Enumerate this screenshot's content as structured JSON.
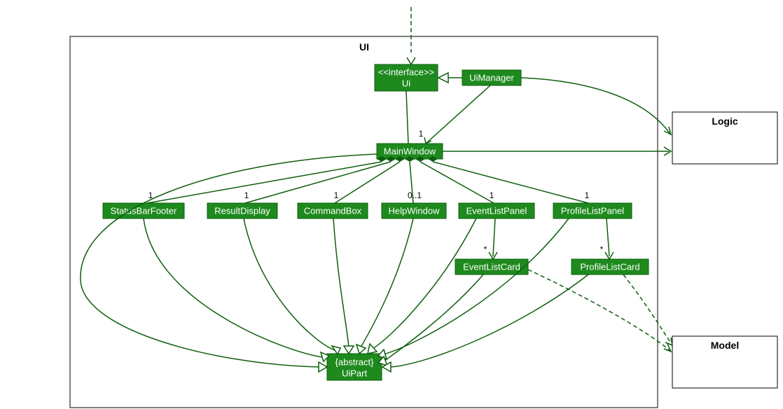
{
  "package": {
    "label": "UI"
  },
  "external": {
    "logic": "Logic",
    "model": "Model"
  },
  "classes": {
    "ui_stereo": "<<interface>>",
    "ui": "Ui",
    "uimanager": "UiManager",
    "mainwindow": "MainWindow",
    "statusbarfooter": "StatusBarFooter",
    "resultdisplay": "ResultDisplay",
    "commandbox": "CommandBox",
    "helpwindow": "HelpWindow",
    "eventlistpanel": "EventListPanel",
    "profilelistpanel": "ProfileListPanel",
    "eventlistcard": "EventListCard",
    "profilelistcard": "ProfileListCard",
    "uipart_stereo": "{abstract}",
    "uipart": "UiPart"
  },
  "mult": {
    "mw": "1",
    "sbf": "1",
    "rd": "1",
    "cb": "1",
    "hw": "0..1",
    "elp": "1",
    "plp": "1",
    "elc": "*",
    "plc": "*"
  },
  "diagram_data": {
    "type": "uml_class_diagram",
    "package": "UI",
    "classes": [
      {
        "name": "Ui",
        "stereotype": "interface"
      },
      {
        "name": "UiManager"
      },
      {
        "name": "MainWindow"
      },
      {
        "name": "StatusBarFooter"
      },
      {
        "name": "ResultDisplay"
      },
      {
        "name": "CommandBox"
      },
      {
        "name": "HelpWindow"
      },
      {
        "name": "EventListPanel"
      },
      {
        "name": "ProfileListPanel"
      },
      {
        "name": "EventListCard"
      },
      {
        "name": "ProfileListCard"
      },
      {
        "name": "UiPart",
        "stereotype": "abstract"
      }
    ],
    "external_classes": [
      "Logic",
      "Model"
    ],
    "relationships": [
      {
        "from": "UiManager",
        "to": "Ui",
        "type": "realization"
      },
      {
        "from": "UiManager",
        "to": "MainWindow",
        "type": "association",
        "mult_to": "1"
      },
      {
        "from": "UiManager",
        "to": "Logic",
        "type": "association"
      },
      {
        "from": "MainWindow",
        "to": "Logic",
        "type": "association"
      },
      {
        "from": "MainWindow",
        "to": "StatusBarFooter",
        "type": "composition",
        "mult_to": "1"
      },
      {
        "from": "MainWindow",
        "to": "ResultDisplay",
        "type": "composition",
        "mult_to": "1"
      },
      {
        "from": "MainWindow",
        "to": "CommandBox",
        "type": "composition",
        "mult_to": "1"
      },
      {
        "from": "MainWindow",
        "to": "HelpWindow",
        "type": "composition",
        "mult_to": "0..1"
      },
      {
        "from": "MainWindow",
        "to": "EventListPanel",
        "type": "composition",
        "mult_to": "1"
      },
      {
        "from": "MainWindow",
        "to": "ProfileListPanel",
        "type": "composition",
        "mult_to": "1"
      },
      {
        "from": "MainWindow",
        "to": "UiPart",
        "type": "generalization"
      },
      {
        "from": "EventListPanel",
        "to": "EventListCard",
        "type": "association",
        "mult_to": "*"
      },
      {
        "from": "ProfileListPanel",
        "to": "ProfileListCard",
        "type": "association",
        "mult_to": "*"
      },
      {
        "from": "StatusBarFooter",
        "to": "UiPart",
        "type": "generalization"
      },
      {
        "from": "ResultDisplay",
        "to": "UiPart",
        "type": "generalization"
      },
      {
        "from": "CommandBox",
        "to": "UiPart",
        "type": "generalization"
      },
      {
        "from": "HelpWindow",
        "to": "UiPart",
        "type": "generalization"
      },
      {
        "from": "EventListPanel",
        "to": "UiPart",
        "type": "generalization"
      },
      {
        "from": "ProfileListPanel",
        "to": "UiPart",
        "type": "generalization"
      },
      {
        "from": "EventListCard",
        "to": "UiPart",
        "type": "generalization"
      },
      {
        "from": "ProfileListCard",
        "to": "UiPart",
        "type": "generalization"
      },
      {
        "from": "EventListCard",
        "to": "Model",
        "type": "dependency"
      },
      {
        "from": "ProfileListCard",
        "to": "Model",
        "type": "dependency"
      },
      {
        "from": "(external)",
        "to": "Ui",
        "type": "dependency"
      }
    ]
  }
}
